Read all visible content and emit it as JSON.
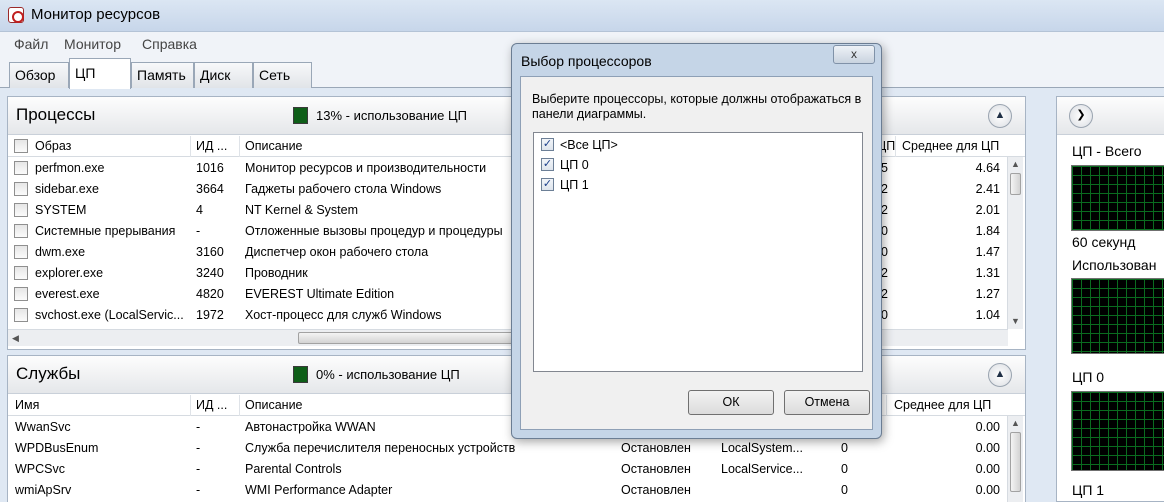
{
  "window": {
    "title": "Монитор ресурсов"
  },
  "menu": [
    "Файл",
    "Монитор",
    "Справка"
  ],
  "tabs": [
    {
      "label": "Обзор",
      "active": false
    },
    {
      "label": "ЦП",
      "active": true
    },
    {
      "label": "Память",
      "active": false
    },
    {
      "label": "Диск",
      "active": false
    },
    {
      "label": "Сеть",
      "active": false
    }
  ],
  "processes": {
    "title": "Процессы",
    "usage": "13% - использование ЦП",
    "columns": {
      "image": "Образ",
      "pid": "ИД ...",
      "description": "Описание",
      "cpu": "ЦП",
      "avg": "Среднее для ЦП"
    },
    "rows": [
      {
        "image": "perfmon.exe",
        "pid": "1016",
        "description": "Монитор ресурсов и производительности",
        "cpu": "5",
        "avg": "4.64"
      },
      {
        "image": "sidebar.exe",
        "pid": "3664",
        "description": "Гаджеты рабочего стола Windows",
        "cpu": "2",
        "avg": "2.41"
      },
      {
        "image": "SYSTEM",
        "pid": "4",
        "description": "NT Kernel & System",
        "cpu": "2",
        "avg": "2.01"
      },
      {
        "image": "Системные прерывания",
        "pid": "-",
        "description": "Отложенные вызовы процедур и процедуры",
        "cpu": "0",
        "avg": "1.84"
      },
      {
        "image": "dwm.exe",
        "pid": "3160",
        "description": "Диспетчер окон рабочего стола",
        "cpu": "0",
        "avg": "1.47"
      },
      {
        "image": "explorer.exe",
        "pid": "3240",
        "description": "Проводник",
        "cpu": "2",
        "avg": "1.31"
      },
      {
        "image": "everest.exe",
        "pid": "4820",
        "description": "EVEREST Ultimate Edition",
        "cpu": "2",
        "avg": "1.27"
      },
      {
        "image": "svchost.exe (LocalServic...",
        "pid": "1972",
        "description": "Хост-процесс для служб Windows",
        "cpu": "0",
        "avg": "1.04"
      }
    ]
  },
  "services": {
    "title": "Службы",
    "usage": "0% - использование ЦП",
    "columns": {
      "name": "Имя",
      "pid": "ИД ...",
      "description": "Описание",
      "avg": "Среднее для ЦП"
    },
    "rows": [
      {
        "name": "WwanSvc",
        "pid": "-",
        "description": "Автонастройка WWAN",
        "status": "",
        "group": "",
        "cpu": "",
        "avg": "0.00"
      },
      {
        "name": "WPDBusEnum",
        "pid": "-",
        "description": "Служба перечислителя переносных устройств",
        "status": "Остановлен",
        "group": "LocalSystem...",
        "cpu": "0",
        "avg": "0.00"
      },
      {
        "name": "WPCSvc",
        "pid": "-",
        "description": "Parental Controls",
        "status": "Остановлен",
        "group": "LocalService...",
        "cpu": "0",
        "avg": "0.00"
      },
      {
        "name": "wmiApSrv",
        "pid": "-",
        "description": "WMI Performance Adapter",
        "status": "Остановлен",
        "group": "",
        "cpu": "0",
        "avg": "0.00"
      }
    ]
  },
  "right_panel": {
    "labels": [
      "ЦП - Всего",
      "60 секунд",
      "Использован",
      "ЦП 0",
      "ЦП 1"
    ]
  },
  "dialog": {
    "title": "Выбор процессоров",
    "close": "x",
    "description": "Выберите процессоры, которые должны отображаться в панели диаграммы.",
    "items": [
      {
        "label": "<Все ЦП>",
        "checked": true
      },
      {
        "label": "ЦП 0",
        "checked": true
      },
      {
        "label": "ЦП 1",
        "checked": true
      }
    ],
    "ok": "ОК",
    "cancel": "Отмена"
  }
}
